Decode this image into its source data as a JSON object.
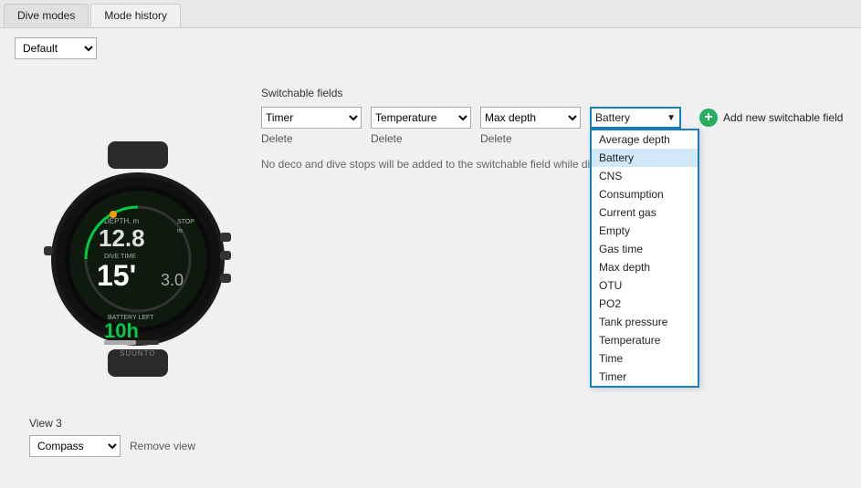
{
  "tabs": [
    {
      "label": "Dive modes",
      "active": false
    },
    {
      "label": "Mode history",
      "active": true
    }
  ],
  "default_dropdown": {
    "value": "Default",
    "options": [
      "Default"
    ]
  },
  "switchable_fields": {
    "label": "Switchable fields",
    "fields": [
      {
        "value": "Timer",
        "options": [
          "Timer",
          "Temperature",
          "Max depth",
          "Battery",
          "Average depth",
          "CNS",
          "Consumption",
          "Current gas",
          "Empty",
          "Gas time",
          "OTU",
          "PO2",
          "Tank pressure",
          "Time"
        ],
        "delete_label": "Delete"
      },
      {
        "value": "Temperature",
        "options": [
          "Timer",
          "Temperature",
          "Max depth",
          "Battery",
          "Average depth",
          "CNS",
          "Consumption",
          "Current gas",
          "Empty",
          "Gas time",
          "OTU",
          "PO2",
          "Tank pressure",
          "Time"
        ],
        "delete_label": "Delete"
      },
      {
        "value": "Max depth",
        "options": [
          "Timer",
          "Temperature",
          "Max depth",
          "Battery",
          "Average depth",
          "CNS",
          "Consumption",
          "Current gas",
          "Empty",
          "Gas time",
          "OTU",
          "PO2",
          "Tank pressure",
          "Time"
        ],
        "delete_label": "Delete"
      }
    ],
    "battery_field": {
      "value": "Battery",
      "dropdown_items": [
        {
          "label": "Average depth",
          "highlighted": false
        },
        {
          "label": "Battery",
          "highlighted": true
        },
        {
          "label": "CNS",
          "highlighted": false
        },
        {
          "label": "Consumption",
          "highlighted": false
        },
        {
          "label": "Current gas",
          "highlighted": false
        },
        {
          "label": "Empty",
          "highlighted": false
        },
        {
          "label": "Gas time",
          "highlighted": false
        },
        {
          "label": "Max depth",
          "highlighted": false
        },
        {
          "label": "OTU",
          "highlighted": false
        },
        {
          "label": "PO2",
          "highlighted": false
        },
        {
          "label": "Tank pressure",
          "highlighted": false
        },
        {
          "label": "Temperature",
          "highlighted": false
        },
        {
          "label": "Time",
          "highlighted": false
        },
        {
          "label": "Timer",
          "highlighted": false
        }
      ]
    },
    "add_button_label": "Add new switchable field"
  },
  "notice_text": "No deco and dive stops will be added to the switchable field while div...",
  "view": {
    "label": "View 3",
    "dropdown_value": "Compass",
    "dropdown_options": [
      "Compass"
    ],
    "remove_label": "Remove view"
  }
}
